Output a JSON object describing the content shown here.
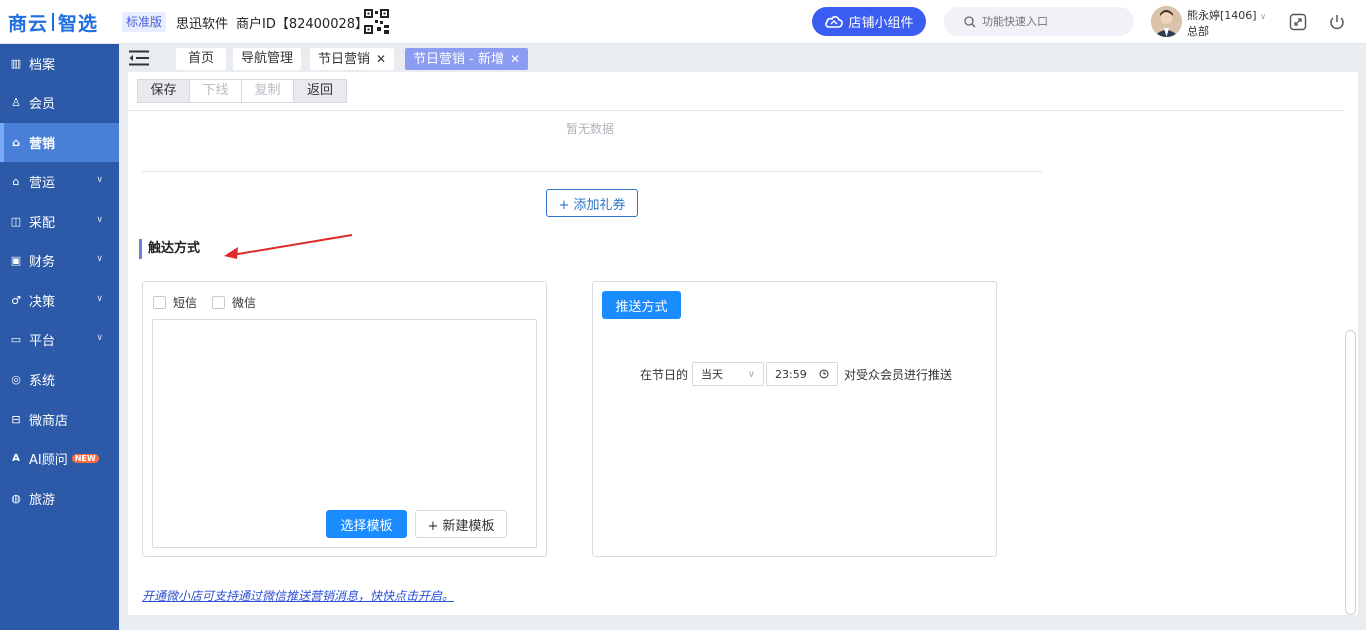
{
  "header": {
    "logo_left": "商云",
    "logo_right": "智选",
    "edition": "标准版",
    "company": "思迅软件",
    "merchant_id": "商户ID【82400028】",
    "widget_button": "店铺小组件",
    "search_placeholder": "功能快速入口",
    "user_name": "熊永婷[1406]",
    "user_dept": "总部"
  },
  "sidebar": {
    "items": [
      {
        "label": "档案",
        "icon": "archive-icon"
      },
      {
        "label": "会员",
        "icon": "user-icon"
      },
      {
        "label": "营销",
        "icon": "shop-icon"
      },
      {
        "label": "营运",
        "icon": "store-icon"
      },
      {
        "label": "采配",
        "icon": "purchase-icon"
      },
      {
        "label": "财务",
        "icon": "finance-icon"
      },
      {
        "label": "决策",
        "icon": "decision-icon"
      },
      {
        "label": "平台",
        "icon": "monitor-icon"
      },
      {
        "label": "系统",
        "icon": "settings-icon"
      },
      {
        "label": "微商店",
        "icon": "microstore-icon"
      },
      {
        "label": "AI顾问",
        "icon": "ai-icon",
        "badge": "NEW"
      },
      {
        "label": "旅游",
        "icon": "travel-icon"
      }
    ]
  },
  "tabs": [
    {
      "label": "首页"
    },
    {
      "label": "导航管理"
    },
    {
      "label": "节日营销"
    },
    {
      "label": "节日营销 - 新增"
    }
  ],
  "toolbar": {
    "save": "保存",
    "offline": "下线",
    "copy": "复制",
    "back": "返回"
  },
  "main": {
    "empty_text": "暂无数据",
    "add_coupon": "+ 添加礼券",
    "section_title": "触达方式",
    "sms_label": "短信",
    "wechat_label": "微信",
    "choose_template": "选择模板",
    "new_template": "+ 新建模板",
    "push_method": "推送方式",
    "push_prefix": "在节日的",
    "day_option": "当天",
    "push_time": "23:59",
    "push_suffix": "对受众会员进行推送",
    "footer_link": "开通微小店可支持通过微信推送营销消息，快快点击开启。"
  },
  "colors": {
    "sidebar_bg": "#2d5aa8",
    "sidebar_active": "#4a7fd8",
    "primary": "#1a8cff",
    "widget": "#3a5cf0",
    "active_tab": "#8b9cf2",
    "annotation_arrow": "#e02a2a"
  }
}
